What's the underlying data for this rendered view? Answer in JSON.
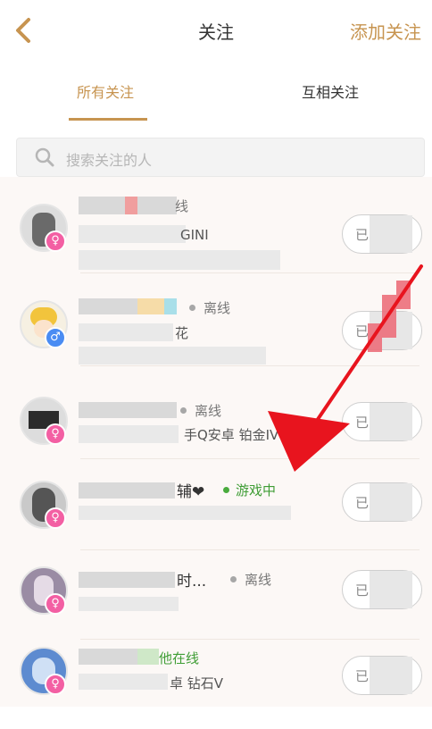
{
  "header": {
    "title": "关注",
    "add_label": "添加关注",
    "accent": "#c79450"
  },
  "tabs": [
    {
      "label": "所有关注",
      "active": true
    },
    {
      "label": "互相关注",
      "active": false
    }
  ],
  "search": {
    "placeholder": "搜索关注的人"
  },
  "list": [
    {
      "name_tail": "",
      "status": "线",
      "sub": "GINI",
      "gender": "female",
      "follow_label": "已"
    },
    {
      "name_tail": "",
      "status": "离线",
      "sub": "花",
      "gender": "male",
      "follow_label": "已"
    },
    {
      "name_tail": "",
      "status": "离线",
      "sub": "手Q安卓 铂金IV",
      "gender": "female",
      "follow_label": "已"
    },
    {
      "name_tail": "辅❤",
      "status": "游戏中",
      "sub": "",
      "gender": "female",
      "follow_label": "已"
    },
    {
      "name_tail": "时...",
      "status": "离线",
      "sub": "",
      "gender": "female",
      "follow_label": "已"
    },
    {
      "name_tail": "",
      "status": "他在线",
      "sub": "卓 钻石V",
      "gender": "female",
      "follow_label": "已"
    }
  ],
  "colors": {
    "online": "#3f9d35",
    "offline": "#a7a7a7",
    "arrow": "#e8141e"
  }
}
